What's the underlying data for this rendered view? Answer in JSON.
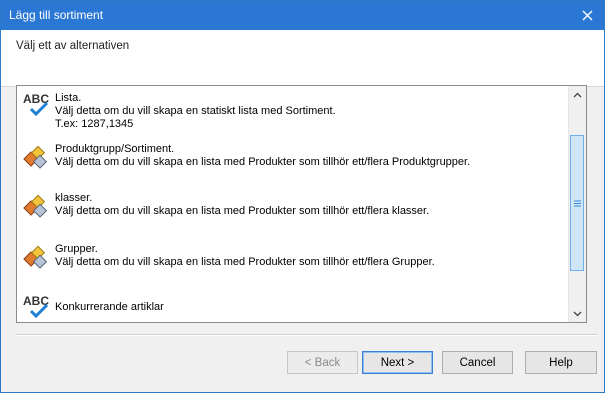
{
  "window": {
    "title": "Lägg till sortiment"
  },
  "header": {
    "subtitle": "Välj ett av alternativen"
  },
  "options": [
    {
      "icon": "spellcheck-abc-icon",
      "lines": [
        "Lista.",
        "Välj detta om du vill skapa en statiskt lista med Sortiment.",
        "T.ex: 1287,1345"
      ]
    },
    {
      "icon": "product-group-icon",
      "lines": [
        "Produktgrupp/Sortiment.",
        "Välj detta om du vill skapa en lista med Produkter som tillhör ett/flera Produktgrupper."
      ]
    },
    {
      "icon": "product-group-icon",
      "lines": [
        "klasser.",
        "Välj detta om du vill skapa en lista med Produkter som tillhör ett/flera klasser."
      ]
    },
    {
      "icon": "product-group-icon",
      "lines": [
        "Grupper.",
        "Välj detta om du vill skapa en lista med Produkter som tillhör ett/flera Grupper."
      ]
    },
    {
      "icon": "spellcheck-abc-icon",
      "lines": [
        "Konkurrerande artiklar"
      ]
    }
  ],
  "buttons": {
    "back": "< Back",
    "next": "Next >",
    "cancel": "Cancel",
    "help": "Help"
  },
  "colors": {
    "titlebar": "#2b78d4",
    "thumb": "#cfe6f9"
  }
}
